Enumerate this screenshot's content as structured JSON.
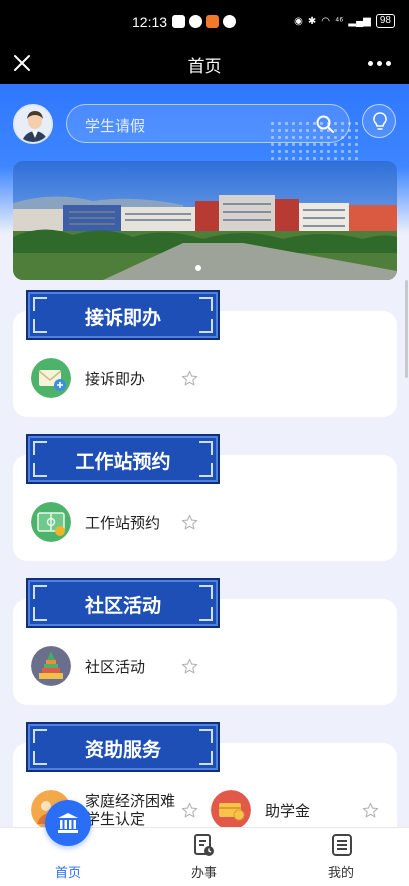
{
  "status_bar": {
    "time": "12:13",
    "network": "⁴⁶",
    "battery": "98"
  },
  "title_bar": {
    "title": "首页"
  },
  "search": {
    "placeholder": "学生请假"
  },
  "sections": [
    {
      "title": "接诉即办",
      "items": [
        {
          "label": "接诉即办",
          "icon": "mail-icon"
        }
      ]
    },
    {
      "title": "工作站预约",
      "items": [
        {
          "label": "工作站预约",
          "icon": "field-icon"
        }
      ]
    },
    {
      "title": "社区活动",
      "items": [
        {
          "label": "社区活动",
          "icon": "tower-icon"
        }
      ]
    },
    {
      "title": "资助服务",
      "items": [
        {
          "label": "家庭经济困难\n学生认定",
          "icon": "family-icon"
        },
        {
          "label": "助学金",
          "icon": "money-icon"
        }
      ]
    }
  ],
  "bottom_nav": [
    {
      "label": "首页",
      "active": true
    },
    {
      "label": "办事",
      "active": false
    },
    {
      "label": "我的",
      "active": false
    }
  ],
  "colors": {
    "primary": "#2a6ef5",
    "section_title": "#1e4fb6",
    "nav_active": "#2a6ef5"
  }
}
